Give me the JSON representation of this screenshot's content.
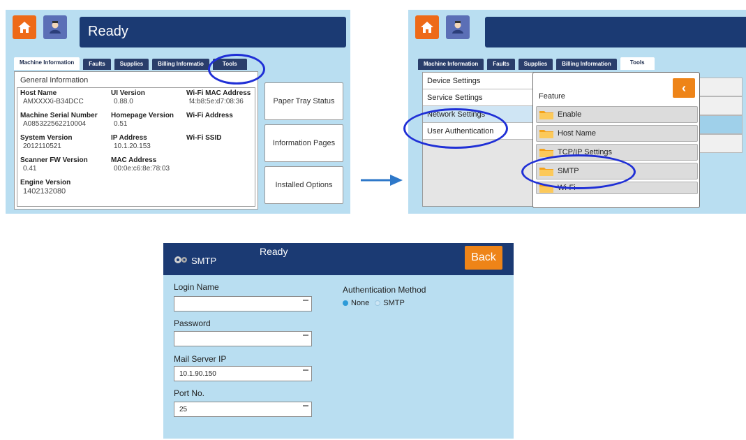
{
  "panel1": {
    "status": "Ready",
    "tabs": [
      "Machine Information",
      "Faults",
      "Supplies",
      "Billing Informatio",
      "Tools"
    ],
    "section_title": "General Information",
    "fields": [
      {
        "key": "Host Name",
        "value": "AMXXXXi-B34DCC"
      },
      {
        "key": "Machine Serial Number",
        "value": "A085322562210004"
      },
      {
        "key": "System Version",
        "value": "2012110521"
      },
      {
        "key": "Scanner FW Version",
        "value": "0.41"
      },
      {
        "key": "Engine Version",
        "value": "1402132080"
      },
      {
        "key": "UI Version",
        "value": "0.88.0"
      },
      {
        "key": "Homepage Version",
        "value": "0.51"
      },
      {
        "key": "IP Address",
        "value": "10.1.20.153"
      },
      {
        "key": "MAC Address",
        "value": "00:0e:c6:8e:78:03"
      },
      {
        "key": "Wi-Fi MAC Address",
        "value": "f4:b8:5e:d7:08:36"
      },
      {
        "key": "Wi-Fi Address",
        "value": ""
      },
      {
        "key": "Wi-Fi SSID",
        "value": ""
      }
    ],
    "buttons": [
      "Paper Tray Status",
      "Information Pages",
      "Installed Options"
    ]
  },
  "panel2": {
    "tabs": [
      "Machine Information",
      "Faults",
      "Supplies",
      "Billing Information",
      "Tools"
    ],
    "left_items": [
      "Device Settings",
      "Service Settings",
      "Network Settings",
      "User Authentication"
    ],
    "popup_title": "Feature",
    "back_glyph": "‹",
    "features": [
      "Enable",
      "Host Name",
      "TCP/IP Settings",
      "SMTP",
      "Wi-Fi"
    ]
  },
  "panel3": {
    "title": "SMTP",
    "status": "Ready",
    "back": "Back",
    "fields": [
      {
        "label": "Login Name",
        "value": ""
      },
      {
        "label": "Password",
        "value": ""
      },
      {
        "label": "Mail Server IP",
        "value": "10.1.90.150"
      },
      {
        "label": "Port No.",
        "value": "25"
      }
    ],
    "auth_label": "Authentication Method",
    "auth_options": [
      "None",
      "SMTP"
    ],
    "auth_selected": "None"
  },
  "colors": {
    "header": "#1b3a73",
    "accent_orange": "#ee8418",
    "highlight": "#1f2fd6",
    "panel_bg": "#b9def1"
  },
  "icons": [
    "home-icon",
    "user-icon",
    "folder-icon",
    "gear-icon",
    "back-arrow-icon",
    "right-arrow-icon"
  ]
}
